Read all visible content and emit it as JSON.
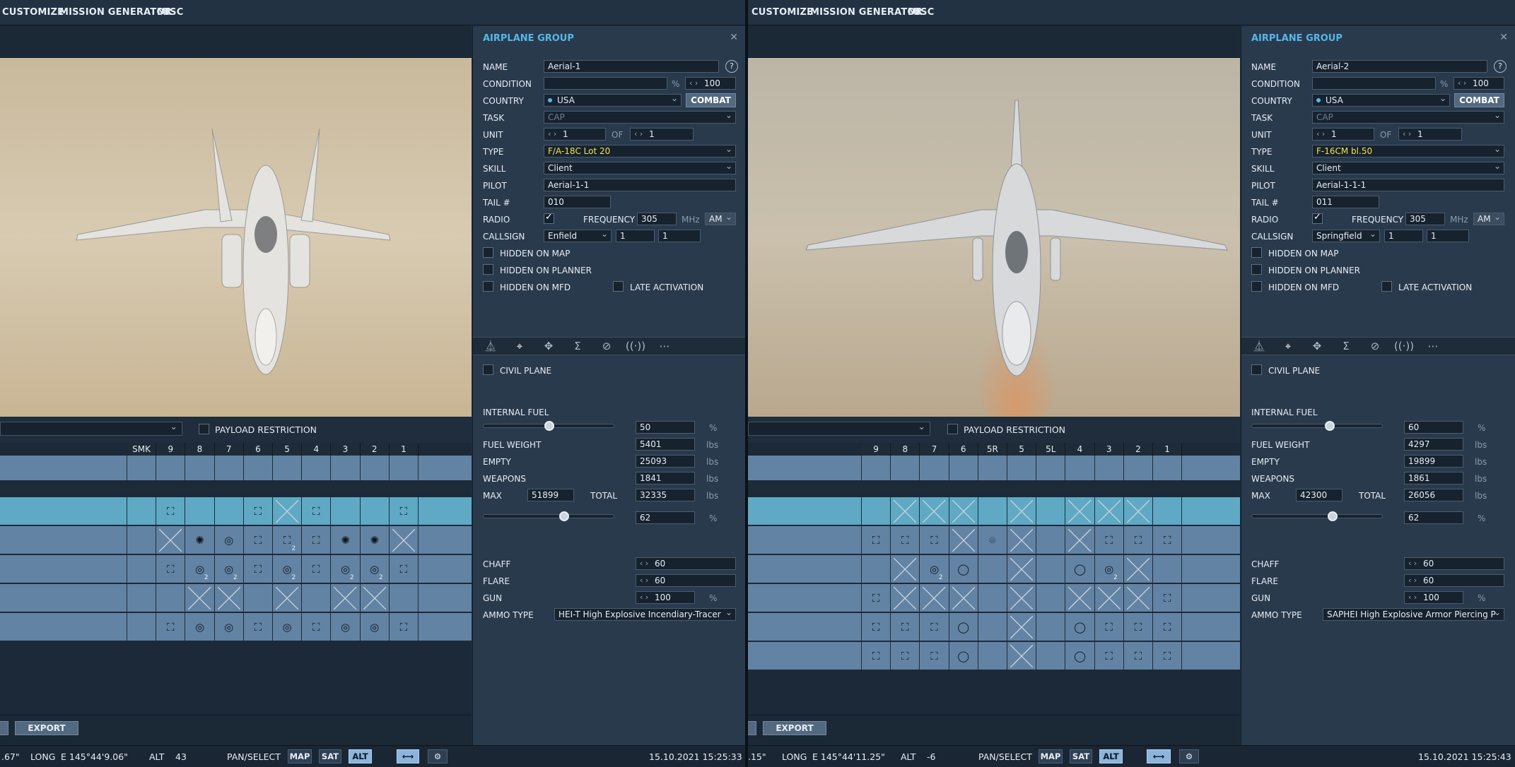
{
  "menu": [
    "CUSTOMIZE",
    "MISSION GENERATOR",
    "MISC"
  ],
  "panels": [
    {
      "title": "AIRPLANE GROUP",
      "name_label": "NAME",
      "name": "Aerial-1",
      "help": "?",
      "condition_label": "CONDITION",
      "condition_pct": "%",
      "condition_value": "100",
      "country_label": "COUNTRY",
      "country": "USA",
      "combat": "COMBAT",
      "task_label": "TASK",
      "task": "CAP",
      "unit_label": "UNIT",
      "unit": "1",
      "of": "OF",
      "unit_of": "1",
      "type_label": "TYPE",
      "type": "F/A-18C Lot 20",
      "skill_label": "SKILL",
      "skill": "Client",
      "pilot_label": "PILOT",
      "pilot": "Aerial-1-1",
      "tail_label": "TAIL #",
      "tail": "010",
      "radio_label": "RADIO",
      "frequency_label": "FREQUENCY",
      "frequency": "305",
      "mhz": "MHz",
      "band": "AM",
      "callsign_label": "CALLSIGN",
      "callsign": "Enfield",
      "callsign_n1": "1",
      "callsign_n2": "1",
      "hidden_map": "HIDDEN ON MAP",
      "hidden_planner": "HIDDEN ON PLANNER",
      "hidden_mfd": "HIDDEN ON MFD",
      "late_activation": "LATE ACTIVATION",
      "civil_plane": "CIVIL PLANE",
      "internal_fuel": "INTERNAL FUEL",
      "fuel_pct_value": "50",
      "fuel_pct": 0.5,
      "pct": "%",
      "fuel_weight_label": "FUEL WEIGHT",
      "fuel_weight": "5401",
      "empty_label": "EMPTY",
      "empty": "25093",
      "weapons_label": "WEAPONS",
      "weapons": "1841",
      "max_label": "MAX",
      "max": "51899",
      "total_label": "TOTAL",
      "total": "32335",
      "lbs": "lbs",
      "load_value": "62",
      "load_pct": 0.62,
      "chaff_label": "CHAFF",
      "chaff": "60",
      "flare_label": "FLARE",
      "flare": "60",
      "gun_label": "GUN",
      "gun": "100",
      "ammo_label": "AMMO TYPE",
      "ammo": "HEI-T High Explosive Incendiary-Tracer"
    },
    {
      "title": "AIRPLANE GROUP",
      "name_label": "NAME",
      "name": "Aerial-2",
      "help": "?",
      "condition_label": "CONDITION",
      "condition_pct": "%",
      "condition_value": "100",
      "country_label": "COUNTRY",
      "country": "USA",
      "combat": "COMBAT",
      "task_label": "TASK",
      "task": "CAP",
      "unit_label": "UNIT",
      "unit": "1",
      "of": "OF",
      "unit_of": "1",
      "type_label": "TYPE",
      "type": "F-16CM bl.50",
      "skill_label": "SKILL",
      "skill": "Client",
      "pilot_label": "PILOT",
      "pilot": "Aerial-1-1-1",
      "tail_label": "TAIL #",
      "tail": "011",
      "radio_label": "RADIO",
      "frequency_label": "FREQUENCY",
      "frequency": "305",
      "mhz": "MHz",
      "band": "AM",
      "callsign_label": "CALLSIGN",
      "callsign": "Springfield",
      "callsign_n1": "1",
      "callsign_n2": "1",
      "hidden_map": "HIDDEN ON MAP",
      "hidden_planner": "HIDDEN ON PLANNER",
      "hidden_mfd": "HIDDEN ON MFD",
      "late_activation": "LATE ACTIVATION",
      "civil_plane": "CIVIL PLANE",
      "internal_fuel": "INTERNAL FUEL",
      "fuel_pct_value": "60",
      "fuel_pct": 0.6,
      "pct": "%",
      "fuel_weight_label": "FUEL WEIGHT",
      "fuel_weight": "4297",
      "empty_label": "EMPTY",
      "empty": "19899",
      "weapons_label": "WEAPONS",
      "weapons": "1861",
      "max_label": "MAX",
      "max": "42300",
      "total_label": "TOTAL",
      "total": "26056",
      "lbs": "lbs",
      "load_value": "62",
      "load_pct": 0.62,
      "chaff_label": "CHAFF",
      "chaff": "60",
      "flare_label": "FLARE",
      "flare": "60",
      "gun_label": "GUN",
      "gun": "100",
      "ammo_label": "AMMO TYPE",
      "ammo": "SAPHEI High Explosive Armor Piercing P"
    }
  ],
  "payload_restriction": "PAYLOAD RESTRICTION",
  "export": "EXPORT",
  "grids": [
    {
      "headers": [
        "SMK",
        "9",
        "8",
        "7",
        "6",
        "5",
        "4",
        "3",
        "2",
        "1"
      ],
      "rows": [
        [
          "",
          "",
          "",
          "",
          "",
          "",
          "",
          "",
          "",
          ""
        ],
        [
          "",
          "",
          "",
          "",
          "",
          "",
          "",
          "",
          "",
          ""
        ],
        [
          "",
          "x",
          "",
          "",
          "x",
          "X",
          "x",
          "",
          "",
          "x"
        ],
        [
          "",
          "X",
          "*",
          "o",
          "x",
          "x2",
          "x",
          "*",
          "*",
          "X"
        ],
        [
          "",
          "x",
          "o2",
          "o2",
          "x",
          "o2",
          "x",
          "o2",
          "o2",
          "x"
        ],
        [
          "",
          "",
          "X",
          "X",
          "",
          "X",
          "",
          "X",
          "X",
          ""
        ],
        [
          "",
          "x",
          "o",
          "o",
          "x",
          "o",
          "x",
          "o",
          "o",
          "x"
        ]
      ]
    },
    {
      "headers": [
        "9",
        "8",
        "7",
        "6",
        "5R",
        "5",
        "5L",
        "4",
        "3",
        "2",
        "1"
      ],
      "rows": [
        [
          "",
          "",
          "",
          "",
          "",
          "",
          "",
          "",
          "",
          "",
          ""
        ],
        [
          "",
          "",
          "",
          "",
          "",
          "",
          "",
          "",
          "",
          "",
          ""
        ],
        [
          "",
          "X",
          "X",
          "X",
          "",
          "X",
          "",
          "X",
          "X",
          "X",
          ""
        ],
        [
          "x",
          "x",
          "x",
          "X",
          "c",
          "X",
          "",
          "X",
          "x",
          "x",
          "x"
        ],
        [
          "",
          "X",
          "o2",
          "q",
          "",
          "X",
          "",
          "q",
          "o2",
          "X",
          ""
        ],
        [
          "x",
          "X",
          "X",
          "X",
          "",
          "X",
          "",
          "X",
          "X",
          "X",
          "x"
        ],
        [
          "x",
          "x",
          "x",
          "q",
          "",
          "X",
          "",
          "q",
          "x",
          "x",
          "x"
        ],
        [
          "x",
          "x",
          "x",
          "q",
          "",
          "X",
          "",
          "q",
          "x",
          "x",
          "x"
        ]
      ]
    }
  ],
  "status": [
    {
      "lat": ".67\"",
      "long_label": "LONG",
      "long": "E 145°44'9.06\"",
      "alt_label": "ALT",
      "alt": "43",
      "pan": "PAN/SELECT",
      "map": "MAP",
      "sat": "SAT",
      "altb": "ALT",
      "datetime": "15.10.2021 15:25:33"
    },
    {
      "lat": ".15\"",
      "long_label": "LONG",
      "long": "E 145°44'11.25\"",
      "alt_label": "ALT",
      "alt": "-6",
      "pan": "PAN/SELECT",
      "map": "MAP",
      "sat": "SAT",
      "altb": "ALT",
      "datetime": "15.10.2021 15:25:43"
    }
  ],
  "icons": [
    "waypoint-icon",
    "payload-icon",
    "drone-icon",
    "sigma-icon",
    "no-entry-icon",
    "radio-icon",
    "more-icon"
  ],
  "colors": {
    "accent": "#55b7e8",
    "selected_row": "#5fa9c4",
    "type_text": "#f2e14b"
  }
}
